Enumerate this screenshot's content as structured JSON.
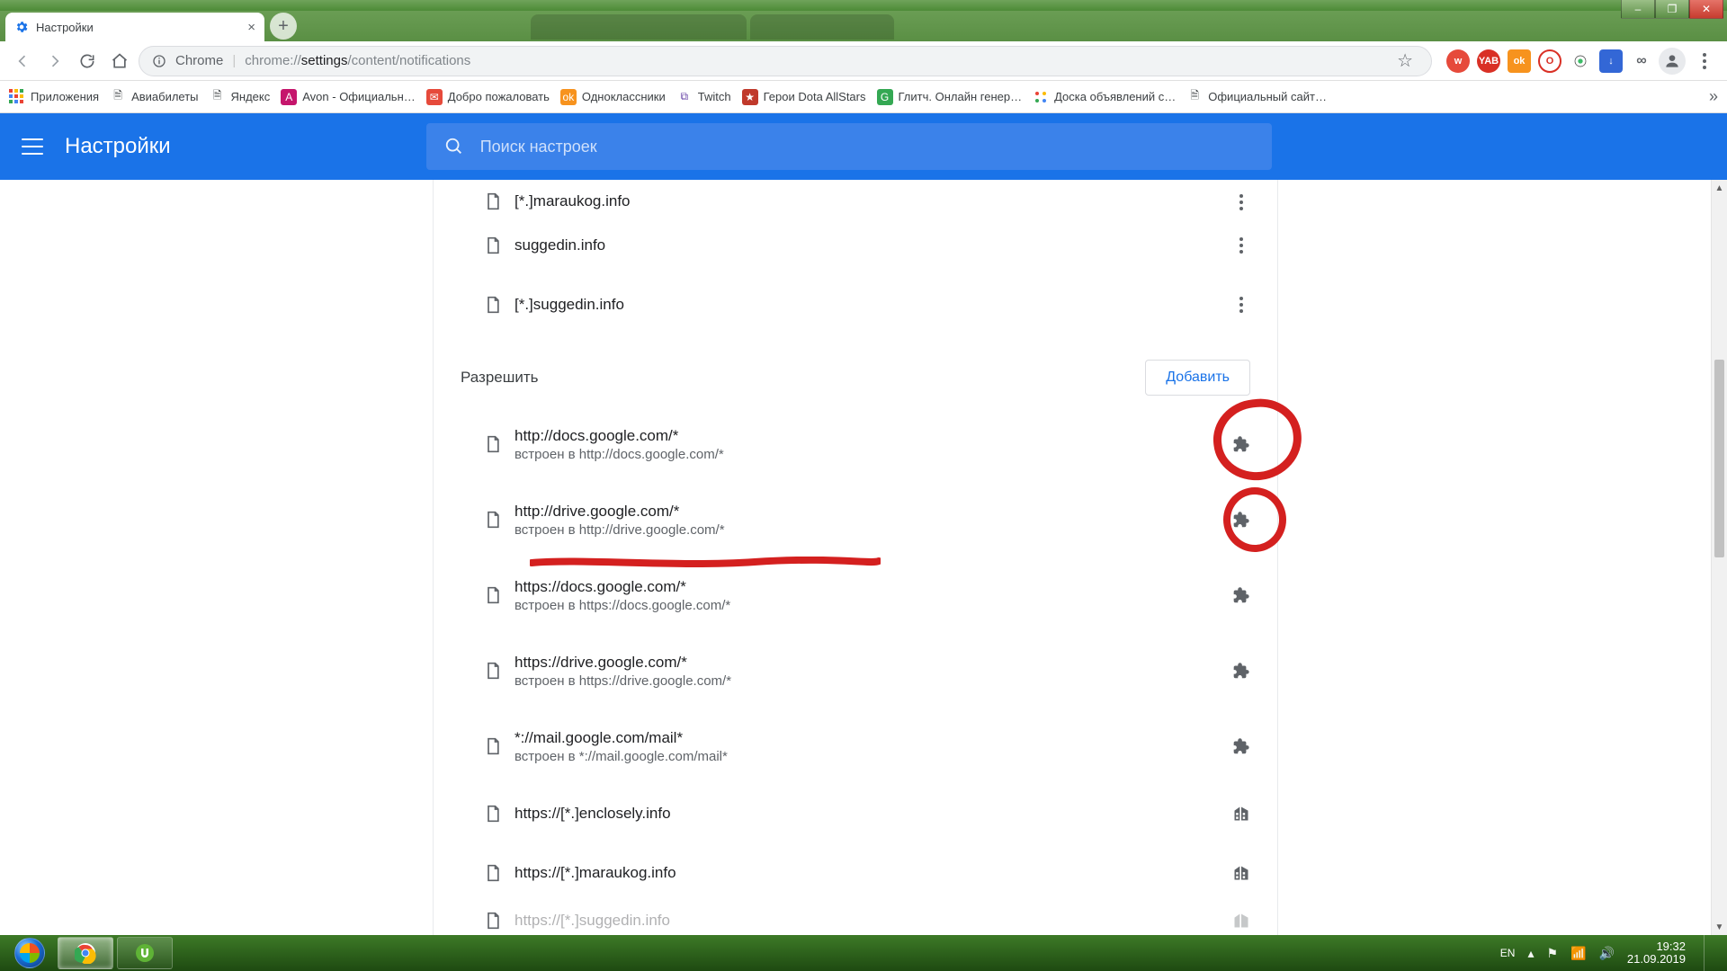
{
  "window": {
    "controls": {
      "min": "–",
      "max": "❐",
      "close": "✕"
    }
  },
  "tab": {
    "title": "Настройки"
  },
  "toolbar": {
    "secure_label": "Chrome",
    "url_prefix": "chrome://",
    "url_bold": "settings",
    "url_suffix": "/content/notifications"
  },
  "bookmarks": {
    "apps": "Приложения",
    "items": [
      {
        "label": "Авиабилеты"
      },
      {
        "label": "Яндекс"
      },
      {
        "label": "Avon - Официальн…"
      },
      {
        "label": "Добро пожаловать"
      },
      {
        "label": "Одноклассники"
      },
      {
        "label": "Twitch"
      },
      {
        "label": "Герои Dota AllStars"
      },
      {
        "label": "Глитч. Онлайн генер…"
      },
      {
        "label": "Доска объявлений с…"
      },
      {
        "label": "Официальный сайт…"
      }
    ]
  },
  "appbar": {
    "title": "Настройки",
    "search_placeholder": "Поиск настроек"
  },
  "block": {
    "items": [
      {
        "site": "[*.]maraukog.info"
      },
      {
        "site": "suggedin.info"
      },
      {
        "site": "[*.]suggedin.info"
      }
    ]
  },
  "allow": {
    "title": "Разрешить",
    "add": "Добавить",
    "items": [
      {
        "site": "http://docs.google.com/*",
        "sub": "встроен в http://docs.google.com/*",
        "icon": "puzzle"
      },
      {
        "site": "http://drive.google.com/*",
        "sub": "встроен в http://drive.google.com/*",
        "icon": "puzzle"
      },
      {
        "site": "https://docs.google.com/*",
        "sub": "встроен в https://docs.google.com/*",
        "icon": "puzzle"
      },
      {
        "site": "https://drive.google.com/*",
        "sub": "встроен в https://drive.google.com/*",
        "icon": "puzzle"
      },
      {
        "site": "*://mail.google.com/mail*",
        "sub": "встроен в *://mail.google.com/mail*",
        "icon": "puzzle"
      },
      {
        "site": "https://[*.]enclosely.info",
        "sub": "",
        "icon": "building"
      },
      {
        "site": "https://[*.]maraukog.info",
        "sub": "",
        "icon": "building"
      },
      {
        "site": "https://[*.]suggedin.info",
        "sub": "",
        "icon": "building"
      }
    ]
  },
  "tray": {
    "lang": "EN",
    "time": "19:32",
    "date": "21.09.2019"
  }
}
